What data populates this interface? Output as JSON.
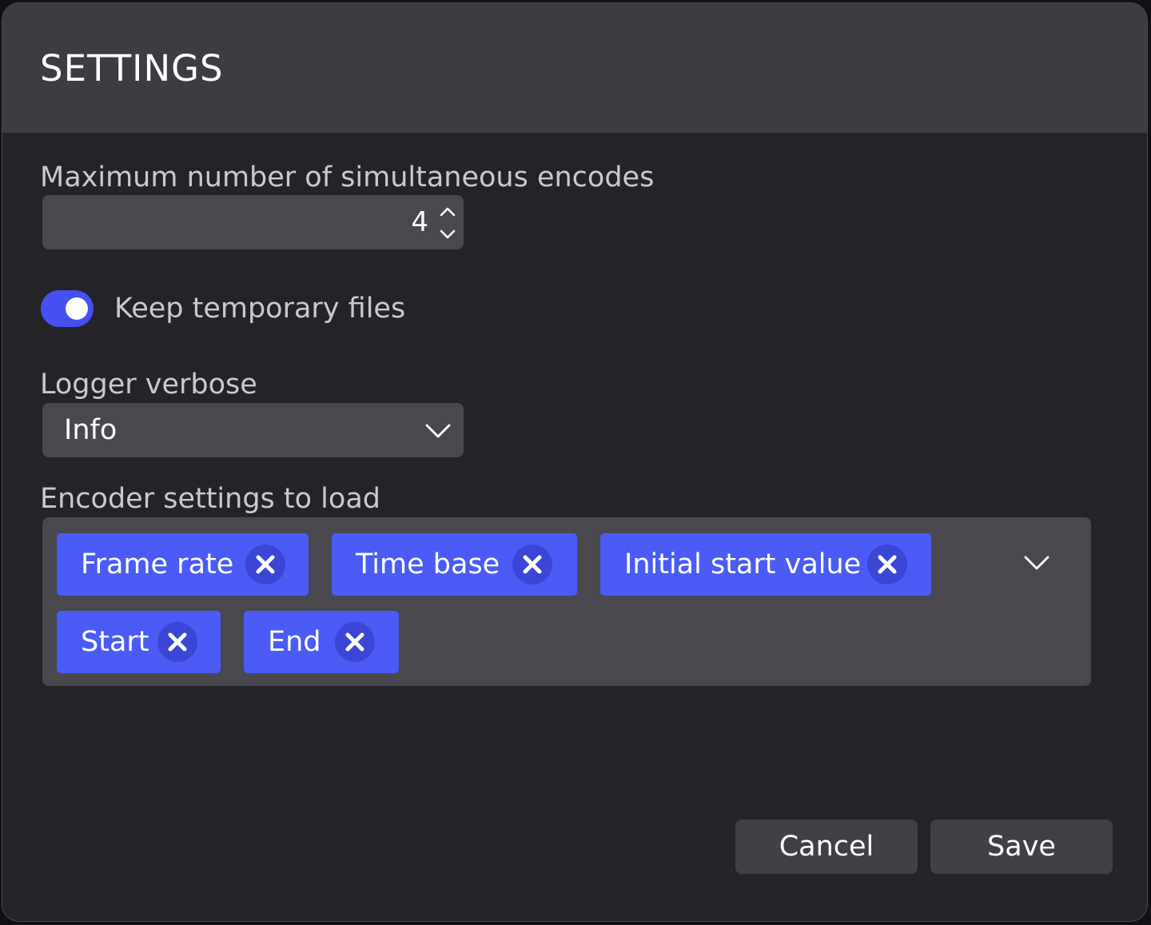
{
  "dialog": {
    "title": "SETTINGS"
  },
  "max_encodes": {
    "label": "Maximum number of simultaneous encodes",
    "value": "4"
  },
  "keep_temp": {
    "label": "Keep temporary files",
    "enabled": true
  },
  "logger": {
    "label": "Logger verbose",
    "selected": "Info"
  },
  "encoder_settings": {
    "label": "Encoder settings to load",
    "chips": [
      {
        "label": "Frame rate"
      },
      {
        "label": "Time base"
      },
      {
        "label": "Initial start value"
      },
      {
        "label": "Start"
      },
      {
        "label": "End"
      }
    ]
  },
  "actions": {
    "cancel_label": "Cancel",
    "save_label": "Save"
  },
  "colors": {
    "accent": "#4a5cf5",
    "toggle_on": "#4650f0",
    "background": "#232328",
    "header": "#3c3c42",
    "field": "#48484e"
  },
  "icons": {
    "spin_up": "chevron-up-icon",
    "spin_down": "chevron-down-icon",
    "select": "chevron-down-icon",
    "chip_remove": "close-icon"
  }
}
